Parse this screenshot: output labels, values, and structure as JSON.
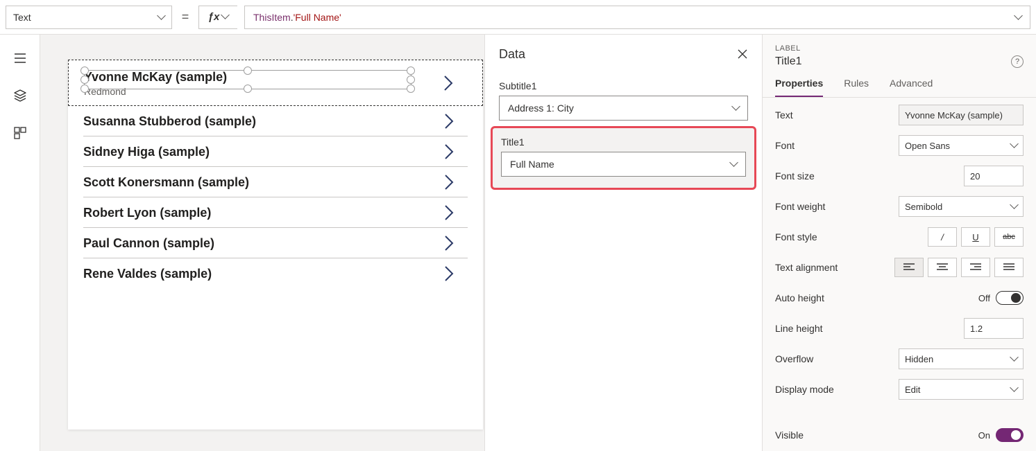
{
  "formula": {
    "property": "Text",
    "expr_kw": "ThisItem",
    "expr_dot": ".",
    "expr_lit": "'Full Name'"
  },
  "gallery": {
    "items": [
      {
        "title": "Yvonne McKay (sample)",
        "sub": "Redmond"
      },
      {
        "title": "Susanna Stubberod (sample)"
      },
      {
        "title": "Sidney Higa (sample)"
      },
      {
        "title": "Scott Konersmann (sample)"
      },
      {
        "title": "Robert Lyon (sample)"
      },
      {
        "title": "Paul Cannon (sample)"
      },
      {
        "title": "Rene Valdes (sample)"
      }
    ]
  },
  "data_pane": {
    "title": "Data",
    "fields": {
      "subtitle_label": "Subtitle1",
      "subtitle_value": "Address 1: City",
      "title_label": "Title1",
      "title_value": "Full Name"
    }
  },
  "props": {
    "tag": "LABEL",
    "name": "Title1",
    "tabs": {
      "properties": "Properties",
      "rules": "Rules",
      "advanced": "Advanced"
    },
    "rows": {
      "text_label": "Text",
      "text_value": "Yvonne McKay (sample)",
      "font_label": "Font",
      "font_value": "Open Sans",
      "fontsize_label": "Font size",
      "fontsize_value": "20",
      "fontweight_label": "Font weight",
      "fontweight_value": "Semibold",
      "fontstyle_label": "Font style",
      "align_label": "Text alignment",
      "autoh_label": "Auto height",
      "autoh_state": "Off",
      "lineh_label": "Line height",
      "lineh_value": "1.2",
      "overflow_label": "Overflow",
      "overflow_value": "Hidden",
      "display_label": "Display mode",
      "display_value": "Edit",
      "visible_label": "Visible",
      "visible_state": "On"
    }
  }
}
